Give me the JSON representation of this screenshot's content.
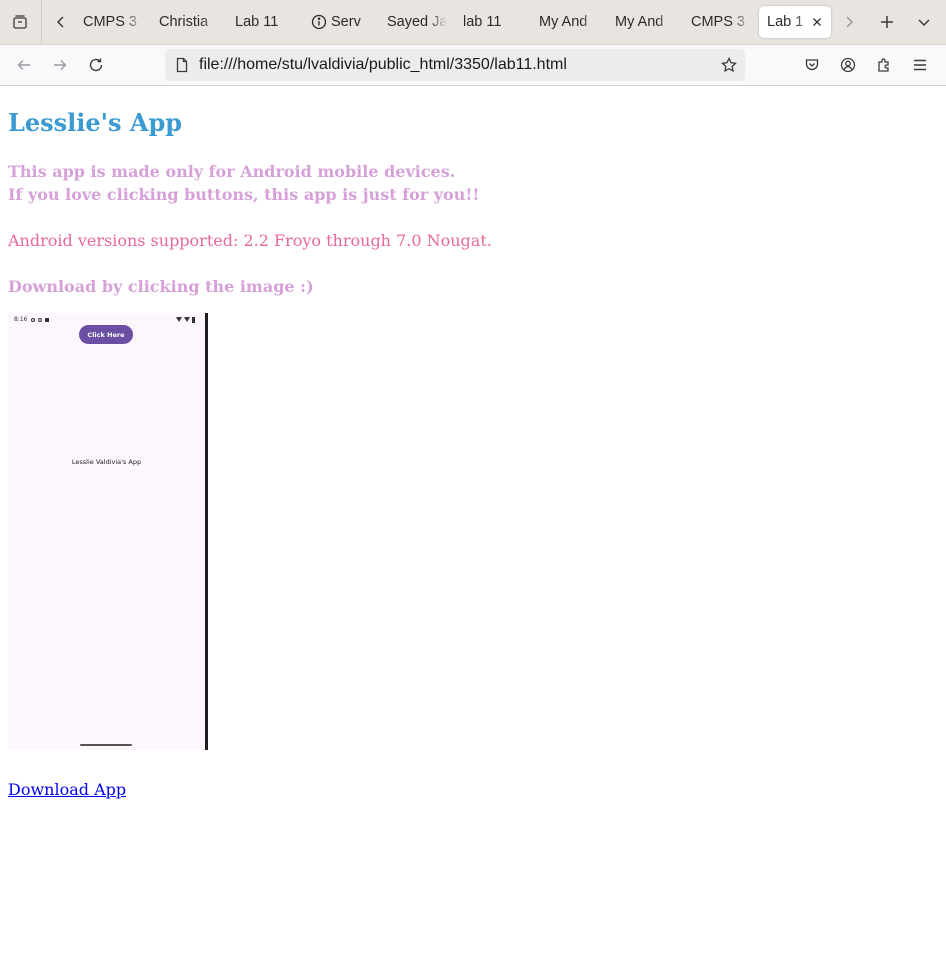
{
  "browser": {
    "tabs": [
      {
        "label": "CMPS 3",
        "fade": true
      },
      {
        "label": "Christia",
        "fade": true
      },
      {
        "label": "Lab 11",
        "fade": false
      },
      {
        "label": "Serv",
        "fade": true,
        "icon": "info-icon"
      },
      {
        "label": "Sayed Ja",
        "fade": true
      },
      {
        "label": "lab 11",
        "fade": false
      },
      {
        "label": "My And",
        "fade": true
      },
      {
        "label": "My And",
        "fade": true
      },
      {
        "label": "CMPS 3",
        "fade": true
      },
      {
        "label": "Lab 1",
        "fade": true,
        "active": true
      }
    ],
    "url": "file:///home/stu/lvaldivia/public_html/3350/lab11.html"
  },
  "page": {
    "heading": "Lesslie's App",
    "desc_line1": "This app is made only for Android mobile devices.",
    "desc_line2": "If you love clicking buttons, this app is just for you!!",
    "versions": "Android versions supported: 2.2 Froyo through 7.0 Nougat.",
    "download_prompt": "Download by clicking the image :)",
    "download_link": "Download App"
  },
  "phone": {
    "time": "8:16",
    "button_label": "Click Here",
    "app_title": "Lesslie Valdivia's App"
  },
  "colors": {
    "heading": "#3b9ad1",
    "desc": "#d6a0d8",
    "versions": "#e8679f",
    "link": "#0000ee",
    "phone_button": "#6a4fa4"
  }
}
